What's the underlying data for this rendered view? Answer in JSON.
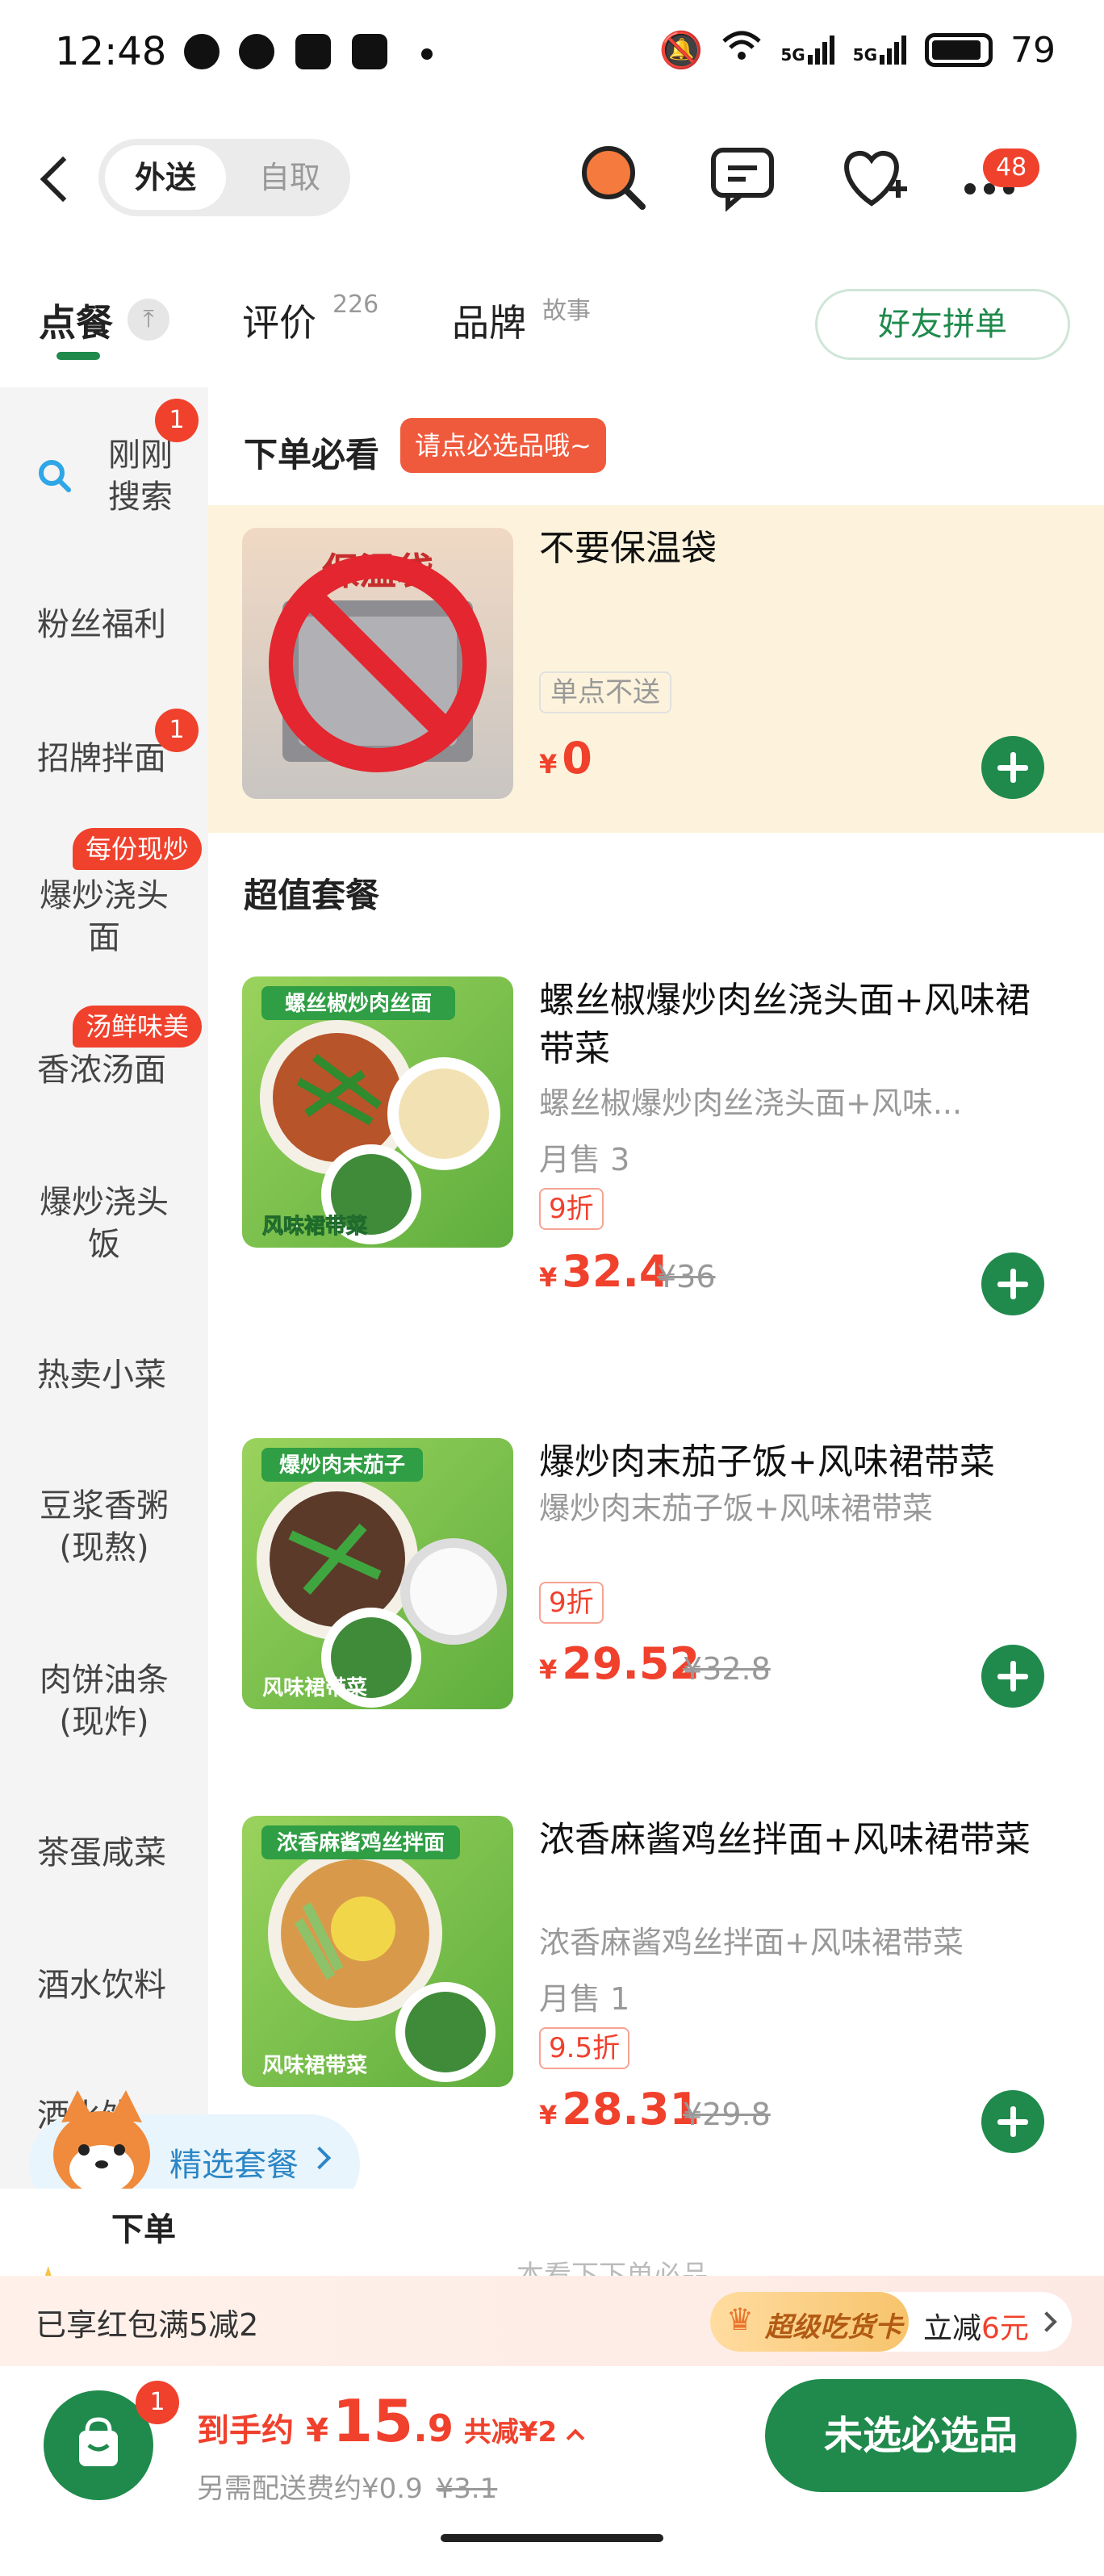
{
  "status": {
    "time": "12:48",
    "battery": "79",
    "signal1": "5G",
    "signal2": "5G"
  },
  "header": {
    "mode_active": "外送",
    "mode_inactive": "自取",
    "cart_badge": "48"
  },
  "tabs": [
    {
      "label": "点餐"
    },
    {
      "label": "评价",
      "sup": "226"
    },
    {
      "label": "品牌",
      "sup": "故事"
    }
  ],
  "friend_order": "好友拼单",
  "sidebar": [
    {
      "label": "刚刚\n搜索",
      "badge": "1"
    },
    {
      "label": "粉丝福利"
    },
    {
      "label": "招牌拌面",
      "badge": "1"
    },
    {
      "label": "爆炒浇头\n面",
      "tag": "每份现炒"
    },
    {
      "label": "香浓汤面",
      "tag": "汤鲜味美"
    },
    {
      "label": "爆炒浇头\n饭"
    },
    {
      "label": "热卖小菜"
    },
    {
      "label": "豆浆香粥\n(现熬)"
    },
    {
      "label": "肉饼油条\n(现炸)"
    },
    {
      "label": "茶蛋咸菜"
    },
    {
      "label": "酒水饮料"
    },
    {
      "label": "酒水饮"
    }
  ],
  "must_see": {
    "title": "下单必看",
    "pill": "请点必选品哦~",
    "item": {
      "name": "不要保温袋",
      "tag": "单点不送",
      "price": "0",
      "yen": "¥",
      "image_text": "保温袋"
    }
  },
  "value_sets": {
    "title": "超值套餐",
    "items": [
      {
        "name": "螺丝椒爆炒肉丝浇头面+风味裙带菜",
        "desc": "螺丝椒爆炒肉丝浇头面+风味...",
        "sales": "月售 3",
        "discount": "9折",
        "price": "32.4",
        "original": "¥36",
        "img_top": "螺丝椒炒肉丝面",
        "img_bottom": "风味裙带菜"
      },
      {
        "name": "爆炒肉末茄子饭+风味裙带菜",
        "desc": "爆炒肉末茄子饭+风味裙带菜",
        "sales": "",
        "discount": "9折",
        "price": "29.52",
        "original": "¥32.8",
        "img_top": "爆炒肉末茄子",
        "img_bottom": "风味裙带菜"
      },
      {
        "name": "浓香麻酱鸡丝拌面+风味裙带菜",
        "desc": "浓香麻酱鸡丝拌面+风味裙带菜",
        "sales": "月售 1",
        "discount": "9.5折",
        "price": "28.31",
        "original": "¥29.8",
        "img_top": "浓香麻酱鸡丝拌面",
        "img_bottom": "风味裙带菜"
      }
    ]
  },
  "floating": {
    "label": "精选套餐"
  },
  "peek": {
    "text": "下单",
    "right": "本看下下单必品"
  },
  "discount_bar": {
    "left": "已享红包满5减2",
    "badge": "超级吃货卡",
    "right_prefix": "立减",
    "right_amount": "6元"
  },
  "bottom": {
    "cart_badge": "1",
    "label": "到手约",
    "yen": "¥",
    "price_int": "15",
    "price_dec": ".9",
    "saved": "共减¥2",
    "delivery": "另需配送费约¥0.9",
    "delivery_orig": "¥3.1",
    "checkout": "未选必选品"
  },
  "colors": {
    "brand": "#1f8a4c",
    "accent": "#f0412d"
  }
}
